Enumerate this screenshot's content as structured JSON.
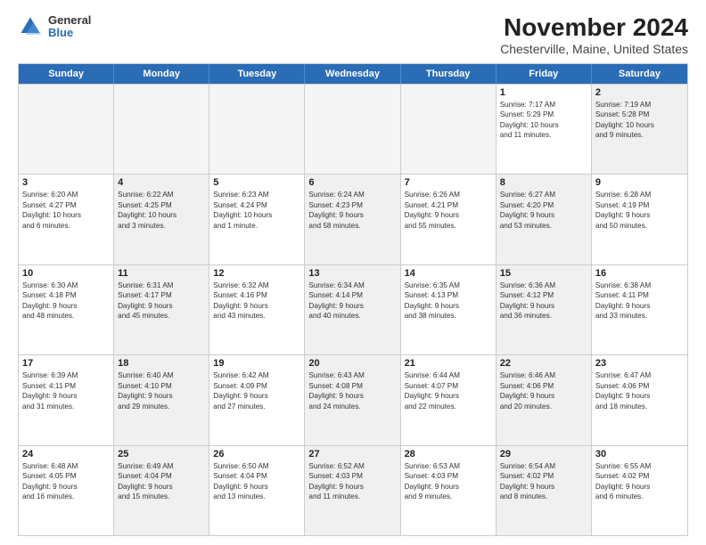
{
  "logo": {
    "general": "General",
    "blue": "Blue"
  },
  "title": "November 2024",
  "subtitle": "Chesterville, Maine, United States",
  "header_days": [
    "Sunday",
    "Monday",
    "Tuesday",
    "Wednesday",
    "Thursday",
    "Friday",
    "Saturday"
  ],
  "rows": [
    {
      "cells": [
        {
          "day": "",
          "info": "",
          "empty": true
        },
        {
          "day": "",
          "info": "",
          "empty": true
        },
        {
          "day": "",
          "info": "",
          "empty": true
        },
        {
          "day": "",
          "info": "",
          "empty": true
        },
        {
          "day": "",
          "info": "",
          "empty": true
        },
        {
          "day": "1",
          "info": "Sunrise: 7:17 AM\nSunset: 5:29 PM\nDaylight: 10 hours\nand 11 minutes.",
          "empty": false
        },
        {
          "day": "2",
          "info": "Sunrise: 7:19 AM\nSunset: 5:28 PM\nDaylight: 10 hours\nand 9 minutes.",
          "empty": false,
          "shaded": true
        }
      ]
    },
    {
      "cells": [
        {
          "day": "3",
          "info": "Sunrise: 6:20 AM\nSunset: 4:27 PM\nDaylight: 10 hours\nand 6 minutes.",
          "empty": false
        },
        {
          "day": "4",
          "info": "Sunrise: 6:22 AM\nSunset: 4:25 PM\nDaylight: 10 hours\nand 3 minutes.",
          "empty": false,
          "shaded": true
        },
        {
          "day": "5",
          "info": "Sunrise: 6:23 AM\nSunset: 4:24 PM\nDaylight: 10 hours\nand 1 minute.",
          "empty": false
        },
        {
          "day": "6",
          "info": "Sunrise: 6:24 AM\nSunset: 4:23 PM\nDaylight: 9 hours\nand 58 minutes.",
          "empty": false,
          "shaded": true
        },
        {
          "day": "7",
          "info": "Sunrise: 6:26 AM\nSunset: 4:21 PM\nDaylight: 9 hours\nand 55 minutes.",
          "empty": false
        },
        {
          "day": "8",
          "info": "Sunrise: 6:27 AM\nSunset: 4:20 PM\nDaylight: 9 hours\nand 53 minutes.",
          "empty": false,
          "shaded": true
        },
        {
          "day": "9",
          "info": "Sunrise: 6:28 AM\nSunset: 4:19 PM\nDaylight: 9 hours\nand 50 minutes.",
          "empty": false
        }
      ]
    },
    {
      "cells": [
        {
          "day": "10",
          "info": "Sunrise: 6:30 AM\nSunset: 4:18 PM\nDaylight: 9 hours\nand 48 minutes.",
          "empty": false
        },
        {
          "day": "11",
          "info": "Sunrise: 6:31 AM\nSunset: 4:17 PM\nDaylight: 9 hours\nand 45 minutes.",
          "empty": false,
          "shaded": true
        },
        {
          "day": "12",
          "info": "Sunrise: 6:32 AM\nSunset: 4:16 PM\nDaylight: 9 hours\nand 43 minutes.",
          "empty": false
        },
        {
          "day": "13",
          "info": "Sunrise: 6:34 AM\nSunset: 4:14 PM\nDaylight: 9 hours\nand 40 minutes.",
          "empty": false,
          "shaded": true
        },
        {
          "day": "14",
          "info": "Sunrise: 6:35 AM\nSunset: 4:13 PM\nDaylight: 9 hours\nand 38 minutes.",
          "empty": false
        },
        {
          "day": "15",
          "info": "Sunrise: 6:36 AM\nSunset: 4:12 PM\nDaylight: 9 hours\nand 36 minutes.",
          "empty": false,
          "shaded": true
        },
        {
          "day": "16",
          "info": "Sunrise: 6:38 AM\nSunset: 4:11 PM\nDaylight: 9 hours\nand 33 minutes.",
          "empty": false
        }
      ]
    },
    {
      "cells": [
        {
          "day": "17",
          "info": "Sunrise: 6:39 AM\nSunset: 4:11 PM\nDaylight: 9 hours\nand 31 minutes.",
          "empty": false
        },
        {
          "day": "18",
          "info": "Sunrise: 6:40 AM\nSunset: 4:10 PM\nDaylight: 9 hours\nand 29 minutes.",
          "empty": false,
          "shaded": true
        },
        {
          "day": "19",
          "info": "Sunrise: 6:42 AM\nSunset: 4:09 PM\nDaylight: 9 hours\nand 27 minutes.",
          "empty": false
        },
        {
          "day": "20",
          "info": "Sunrise: 6:43 AM\nSunset: 4:08 PM\nDaylight: 9 hours\nand 24 minutes.",
          "empty": false,
          "shaded": true
        },
        {
          "day": "21",
          "info": "Sunrise: 6:44 AM\nSunset: 4:07 PM\nDaylight: 9 hours\nand 22 minutes.",
          "empty": false
        },
        {
          "day": "22",
          "info": "Sunrise: 6:46 AM\nSunset: 4:06 PM\nDaylight: 9 hours\nand 20 minutes.",
          "empty": false,
          "shaded": true
        },
        {
          "day": "23",
          "info": "Sunrise: 6:47 AM\nSunset: 4:06 PM\nDaylight: 9 hours\nand 18 minutes.",
          "empty": false
        }
      ]
    },
    {
      "cells": [
        {
          "day": "24",
          "info": "Sunrise: 6:48 AM\nSunset: 4:05 PM\nDaylight: 9 hours\nand 16 minutes.",
          "empty": false
        },
        {
          "day": "25",
          "info": "Sunrise: 6:49 AM\nSunset: 4:04 PM\nDaylight: 9 hours\nand 15 minutes.",
          "empty": false,
          "shaded": true
        },
        {
          "day": "26",
          "info": "Sunrise: 6:50 AM\nSunset: 4:04 PM\nDaylight: 9 hours\nand 13 minutes.",
          "empty": false
        },
        {
          "day": "27",
          "info": "Sunrise: 6:52 AM\nSunset: 4:03 PM\nDaylight: 9 hours\nand 11 minutes.",
          "empty": false,
          "shaded": true
        },
        {
          "day": "28",
          "info": "Sunrise: 6:53 AM\nSunset: 4:03 PM\nDaylight: 9 hours\nand 9 minutes.",
          "empty": false
        },
        {
          "day": "29",
          "info": "Sunrise: 6:54 AM\nSunset: 4:02 PM\nDaylight: 9 hours\nand 8 minutes.",
          "empty": false,
          "shaded": true
        },
        {
          "day": "30",
          "info": "Sunrise: 6:55 AM\nSunset: 4:02 PM\nDaylight: 9 hours\nand 6 minutes.",
          "empty": false
        }
      ]
    }
  ]
}
